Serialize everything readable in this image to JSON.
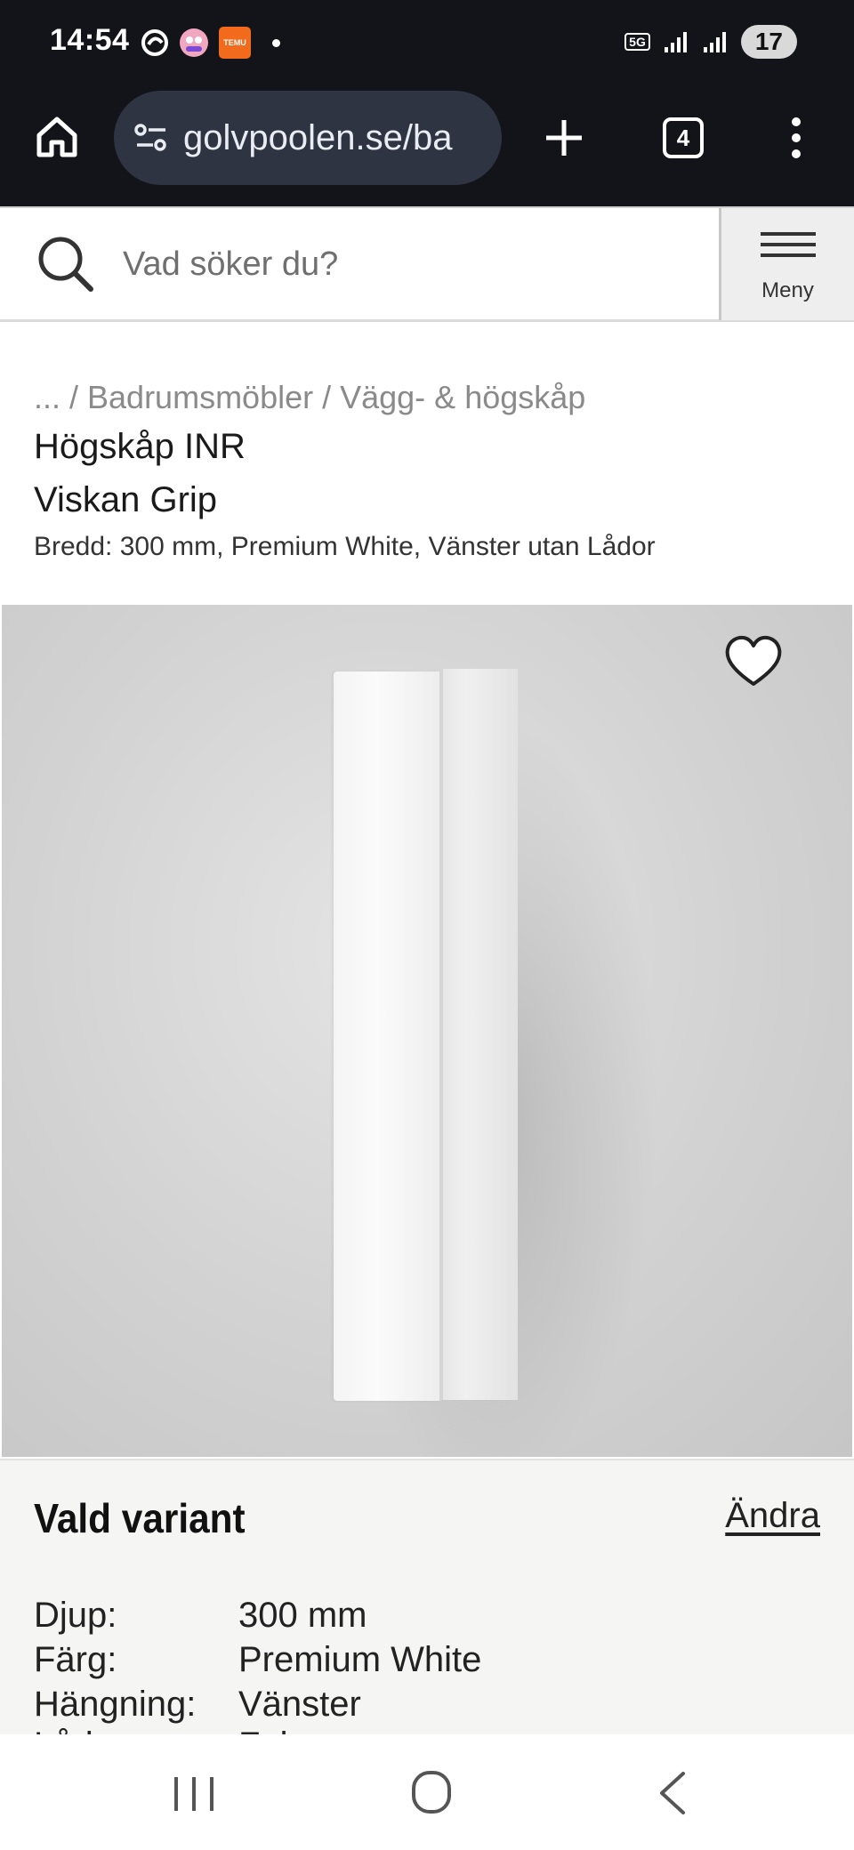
{
  "status_bar": {
    "time": "14:54",
    "app_badge": "TEMU",
    "network": "5G",
    "battery": "17"
  },
  "browser": {
    "url": "golvpoolen.se/ba",
    "tab_count": "4"
  },
  "search": {
    "placeholder": "Vad söker du?"
  },
  "menu": {
    "label": "Meny"
  },
  "breadcrumb": "... / Badrumsmöbler / Vägg- & högskåp",
  "product": {
    "title_line1": "Högskåp INR",
    "title_line2": "Viskan Grip",
    "subtitle": "Bredd: 300 mm, Premium White, Vänster utan Lådor"
  },
  "variant": {
    "heading": "Vald variant",
    "change_label": "Ändra",
    "specs": [
      {
        "label": "Djup:",
        "value": "300 mm"
      },
      {
        "label": "Färg:",
        "value": "Premium White"
      },
      {
        "label": "Hängning:",
        "value": "Vänster"
      },
      {
        "label": "Låda:",
        "value": "False"
      }
    ]
  },
  "colors": {
    "browser_bg": "#12141a",
    "url_pill": "#2e3442",
    "variant_bg": "#f5f6f4"
  }
}
